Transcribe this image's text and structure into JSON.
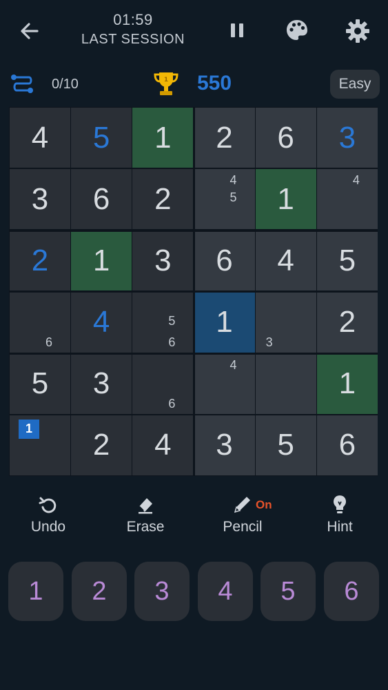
{
  "header": {
    "timer": "01:59",
    "session_label": "LAST SESSION"
  },
  "stats": {
    "progress": "0/10",
    "score": "550",
    "difficulty": "Easy"
  },
  "board": {
    "rows": [
      [
        {
          "v": "4"
        },
        {
          "v": "5",
          "style": "blue"
        },
        {
          "v": "1",
          "bg": "green"
        },
        {
          "v": "2"
        },
        {
          "v": "6"
        },
        {
          "v": "3",
          "style": "blue"
        }
      ],
      [
        {
          "v": "3"
        },
        {
          "v": "6"
        },
        {
          "v": "2"
        },
        {
          "notes": [
            "4",
            "5"
          ]
        },
        {
          "v": "1",
          "bg": "green"
        },
        {
          "notes": [
            "4"
          ]
        }
      ],
      [
        {
          "v": "2",
          "style": "blue"
        },
        {
          "v": "1",
          "bg": "green"
        },
        {
          "v": "3"
        },
        {
          "v": "6"
        },
        {
          "v": "4"
        },
        {
          "v": "5"
        }
      ],
      [
        {
          "notes": [
            "6"
          ]
        },
        {
          "v": "4",
          "style": "blue"
        },
        {
          "notes": [
            "5",
            "6"
          ]
        },
        {
          "v": "1",
          "bg": "blue"
        },
        {
          "notes": [
            "3"
          ]
        },
        {
          "v": "2"
        }
      ],
      [
        {
          "v": "5"
        },
        {
          "v": "3"
        },
        {
          "notes": [
            "6"
          ]
        },
        {
          "notes": [
            "4"
          ]
        },
        {},
        {
          "v": "1",
          "bg": "green"
        }
      ],
      [
        {
          "badge": "1"
        },
        {
          "v": "2"
        },
        {
          "v": "4"
        },
        {
          "v": "3"
        },
        {
          "v": "5"
        },
        {
          "v": "6"
        }
      ]
    ]
  },
  "tools": {
    "undo": "Undo",
    "erase": "Erase",
    "pencil": "Pencil",
    "pencil_state": "On",
    "hint": "Hint"
  },
  "numpad": [
    "1",
    "2",
    "3",
    "4",
    "5",
    "6"
  ],
  "colors": {
    "background": "#0f1a24",
    "accent_blue": "#2a78d6",
    "cell_green": "#2a5a3e",
    "cell_blue": "#1b4a73",
    "numpad_text": "#b98ad6",
    "pencil_on": "#e8532a",
    "trophy": "#f2b705"
  },
  "icons": {
    "back": "arrow-left-icon",
    "pause": "pause-icon",
    "palette": "palette-icon",
    "settings": "gear-icon",
    "streak": "path-icon",
    "trophy": "trophy-icon",
    "undo": "undo-icon",
    "erase": "eraser-icon",
    "pencil": "pencil-icon",
    "hint": "lightbulb-icon"
  }
}
